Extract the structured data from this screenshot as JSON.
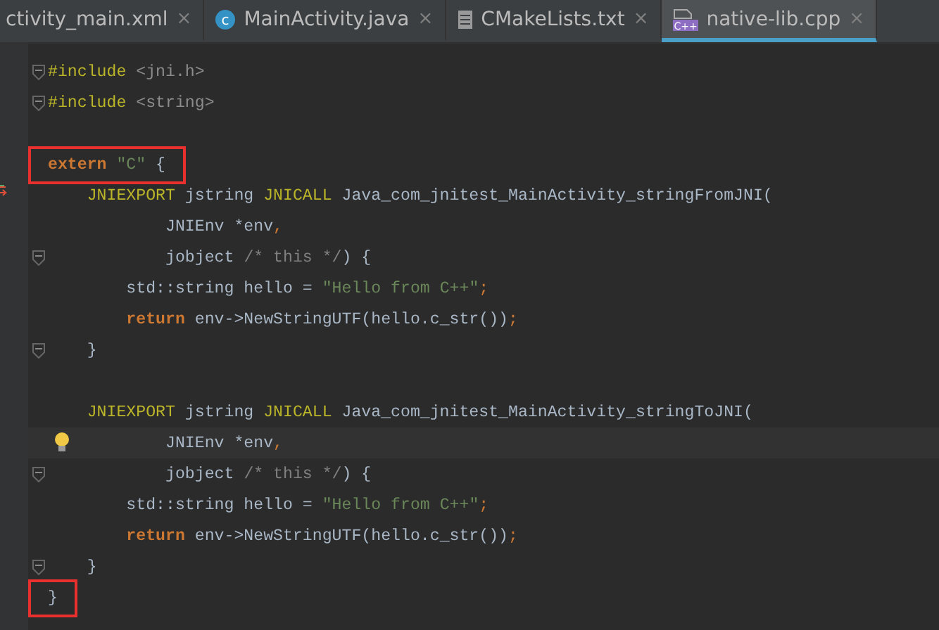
{
  "tabs": [
    {
      "label": "ctivity_main.xml",
      "kind": "xml",
      "selected": false,
      "close": "×"
    },
    {
      "label": "MainActivity.java",
      "kind": "class",
      "icon_letter": "c",
      "selected": false,
      "close": "×"
    },
    {
      "label": "CMakeLists.txt",
      "kind": "text",
      "selected": false,
      "close": "×"
    },
    {
      "label": "native-lib.cpp",
      "kind": "cpp",
      "icon_letter": "C++",
      "selected": true,
      "close": "×"
    }
  ],
  "lines": [
    {
      "kind": "fold",
      "tokens": [
        {
          "kind": "directive",
          "text": "#include"
        },
        {
          "kind": "header",
          "text": " <jni.h>"
        }
      ]
    },
    {
      "kind": "fold",
      "tokens": [
        {
          "kind": "directive",
          "text": "#include"
        },
        {
          "kind": "header",
          "text": " <string>"
        }
      ]
    },
    {
      "kind": "blank"
    },
    {
      "kind": "plain",
      "highlighted": true,
      "tokens": [
        {
          "kind": "keyword",
          "text": "extern "
        },
        {
          "kind": "string",
          "text": "\"C\""
        },
        {
          "kind": "plain",
          "text": " {"
        }
      ]
    },
    {
      "kind": "arrow",
      "tokens": [
        {
          "kind": "macro",
          "text": "    JNIEXPORT"
        },
        {
          "kind": "plain",
          "text": " jstring "
        },
        {
          "kind": "macro",
          "text": "JNICALL"
        },
        {
          "kind": "plain",
          "text": " Java_com_jnitest_MainActivity_stringFromJNI("
        }
      ]
    },
    {
      "kind": "plain",
      "tokens": [
        {
          "kind": "plain",
          "text": "            JNIEnv *env"
        },
        {
          "kind": "punct",
          "text": ","
        }
      ]
    },
    {
      "kind": "fold",
      "tokens": [
        {
          "kind": "plain",
          "text": "            jobject "
        },
        {
          "kind": "comment",
          "text": "/* this */"
        },
        {
          "kind": "plain",
          "text": ") {"
        }
      ]
    },
    {
      "kind": "plain",
      "tokens": [
        {
          "kind": "plain",
          "text": "        std::string hello = "
        },
        {
          "kind": "string",
          "text": "\"Hello from C++\""
        },
        {
          "kind": "punct",
          "text": ";"
        }
      ]
    },
    {
      "kind": "plain",
      "tokens": [
        {
          "kind": "keyword",
          "text": "        return"
        },
        {
          "kind": "plain",
          "text": " env->NewStringUTF(hello.c_str())"
        },
        {
          "kind": "punct",
          "text": ";"
        }
      ]
    },
    {
      "kind": "fold",
      "tokens": [
        {
          "kind": "plain",
          "text": "    }"
        }
      ]
    },
    {
      "kind": "blank"
    },
    {
      "kind": "plain",
      "tokens": [
        {
          "kind": "macro",
          "text": "    JNIEXPORT"
        },
        {
          "kind": "plain",
          "text": " jstring "
        },
        {
          "kind": "macro",
          "text": "JNICALL"
        },
        {
          "kind": "plain",
          "text": " Java_com_jnitest_MainActivity_stringToJNI("
        }
      ]
    },
    {
      "kind": "bulb",
      "current": true,
      "tokens": [
        {
          "kind": "plain",
          "text": "            JNIEnv *env"
        },
        {
          "kind": "punct",
          "text": ","
        }
      ]
    },
    {
      "kind": "fold",
      "tokens": [
        {
          "kind": "plain",
          "text": "            jobject "
        },
        {
          "kind": "comment",
          "text": "/* this */"
        },
        {
          "kind": "plain",
          "text": ") {"
        }
      ]
    },
    {
      "kind": "plain",
      "tokens": [
        {
          "kind": "plain",
          "text": "        std::string hello = "
        },
        {
          "kind": "string",
          "text": "\"Hello from C++\""
        },
        {
          "kind": "punct",
          "text": ";"
        }
      ]
    },
    {
      "kind": "plain",
      "tokens": [
        {
          "kind": "keyword",
          "text": "        return"
        },
        {
          "kind": "plain",
          "text": " env->NewStringUTF(hello.c_str())"
        },
        {
          "kind": "punct",
          "text": ";"
        }
      ]
    },
    {
      "kind": "fold",
      "tokens": [
        {
          "kind": "plain",
          "text": "    }"
        }
      ]
    },
    {
      "kind": "plain",
      "highlighted": true,
      "tokens": [
        {
          "kind": "plain",
          "text": "}"
        }
      ]
    }
  ]
}
